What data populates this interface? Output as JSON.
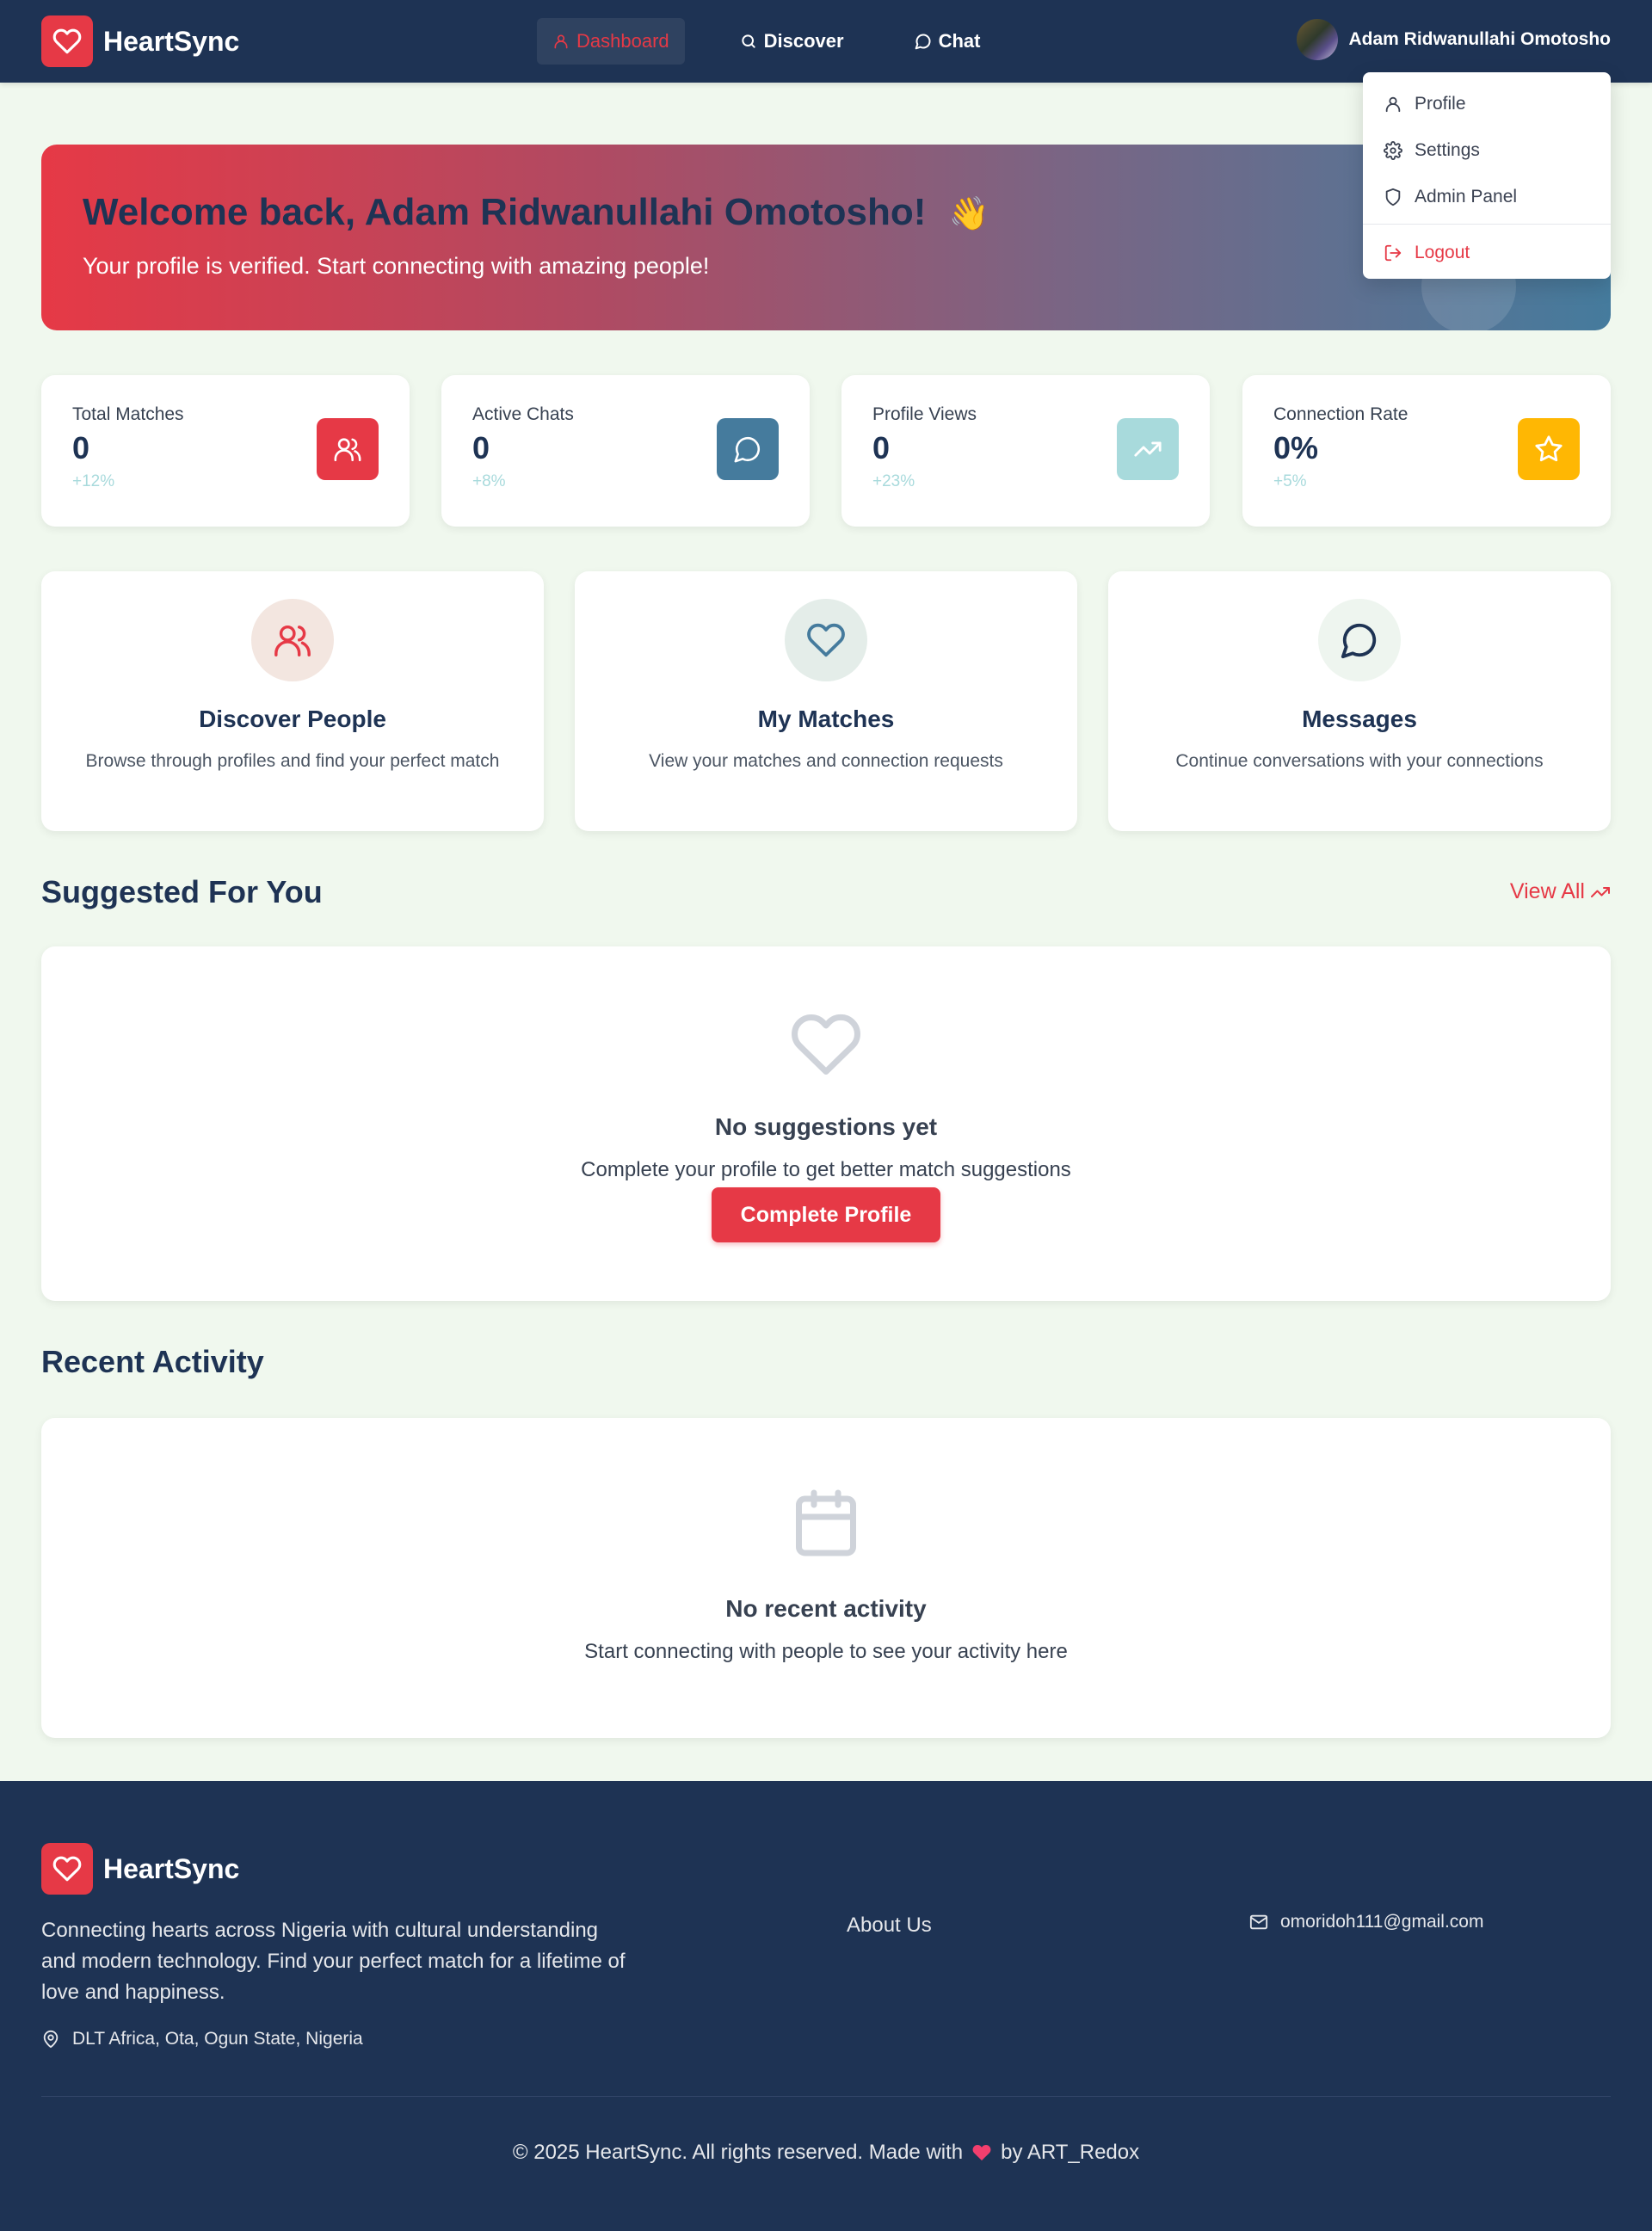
{
  "header": {
    "brand": "HeartSync",
    "nav": [
      {
        "label": "Dashboard",
        "icon": "user-icon",
        "active": true
      },
      {
        "label": "Discover",
        "icon": "search-icon",
        "active": false
      },
      {
        "label": "Chat",
        "icon": "chat-icon",
        "active": false
      }
    ],
    "user_name": "Adam Ridwanullahi Omotosho"
  },
  "user_menu": {
    "items": [
      {
        "label": "Profile",
        "icon": "user-icon"
      },
      {
        "label": "Settings",
        "icon": "gear-icon"
      },
      {
        "label": "Admin Panel",
        "icon": "shield-icon"
      }
    ],
    "logout": "Logout"
  },
  "banner": {
    "title": "Welcome back, Adam Ridwanullahi Omotosho!",
    "emoji": "👋",
    "subtitle": "Your profile is verified. Start connecting with amazing people!"
  },
  "stats": [
    {
      "label": "Total Matches",
      "value": "0",
      "change": "+12%",
      "icon": "users-icon",
      "color": "#e63946"
    },
    {
      "label": "Active Chats",
      "value": "0",
      "change": "+8%",
      "icon": "chat-icon",
      "color": "#457b9d"
    },
    {
      "label": "Profile Views",
      "value": "0",
      "change": "+23%",
      "icon": "trending-up-icon",
      "color": "#a8dadc"
    },
    {
      "label": "Connection Rate",
      "value": "0%",
      "change": "+5%",
      "icon": "star-icon",
      "color": "#ffb703"
    }
  ],
  "features": [
    {
      "title": "Discover People",
      "desc": "Browse through profiles and find your perfect match",
      "icon": "users-icon"
    },
    {
      "title": "My Matches",
      "desc": "View your matches and connection requests",
      "icon": "heart-icon"
    },
    {
      "title": "Messages",
      "desc": "Continue conversations with your connections",
      "icon": "chat-icon"
    }
  ],
  "suggested": {
    "title": "Suggested For You",
    "view_all": "View All",
    "empty_title": "No suggestions yet",
    "empty_desc": "Complete your profile to get better match suggestions",
    "cta": "Complete Profile"
  },
  "activity": {
    "title": "Recent Activity",
    "empty_title": "No recent activity",
    "empty_desc": "Start connecting with people to see your activity here"
  },
  "footer": {
    "brand": "HeartSync",
    "tagline": "Connecting hearts across Nigeria with cultural understanding and modern technology. Find your perfect match for a lifetime of love and happiness.",
    "location": "DLT Africa, Ota, Ogun State, Nigeria",
    "about": "About Us",
    "email": "omoridoh111@gmail.com",
    "copyright_prefix": "© 2025 HeartSync. All rights reserved. Made with",
    "copyright_suffix": "by ART_Redox"
  },
  "colors": {
    "brand": "#e63946",
    "navy": "#1e3354",
    "blue": "#457b9d",
    "light_teal": "#a8dadc",
    "yellow": "#ffb703",
    "page_bg": "#f0f8ee"
  }
}
